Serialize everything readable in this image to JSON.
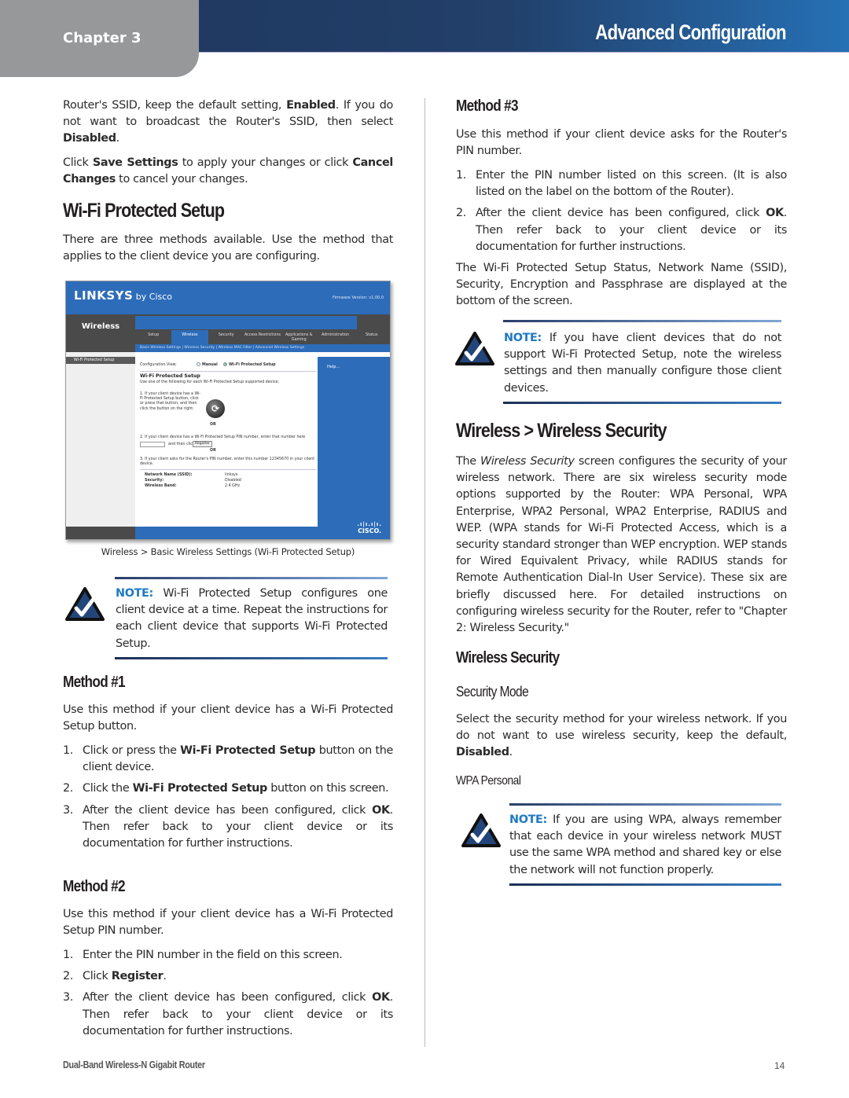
{
  "header": {
    "chapter": "Chapter 3",
    "title": "Advanced Configuration",
    "colors": {
      "bar_start": "#1e355c",
      "bar_end": "#2670b5",
      "tab": "#97989a"
    }
  },
  "left": {
    "intro1": {
      "pre": "Router's SSID, keep the default setting, ",
      "b1": "Enabled",
      "mid": ". If you do not want to broadcast the Router's SSID, then select ",
      "b2": "Disabled",
      "post": "."
    },
    "intro2": {
      "pre": "Click ",
      "b1": "Save Settings",
      "mid": " to apply your changes or click ",
      "b2": "Cancel Changes",
      "post": " to cancel your changes."
    },
    "wps_heading": "Wi-Fi Protected Setup",
    "wps_intro": "There are three methods available. Use the method that applies to the client device you are configuring.",
    "figure": {
      "logo": "LINKSYS",
      "logo_suffix": "by Cisco",
      "firmware": "Firmware Version: v1.00.0",
      "section": "Wireless",
      "tabs": [
        "Setup",
        "Wireless",
        "Security",
        "Access Restrictions",
        "Applications & Gaming",
        "Administration",
        "Status"
      ],
      "active_tab": "Wireless",
      "subnav": "Basic Wireless Settings   |   Wireless Security   |   Wireless MAC Filter   |   Advanced Wireless Settings",
      "side_item": "Wi-Fi Protected Setup",
      "config_view_label": "Configuration View:",
      "radio_manual": "Manual",
      "radio_wps": "Wi-Fi Protected Setup",
      "wps_title": "Wi-Fi Protected Setup",
      "wps_desc": "Use one of the following for each Wi-Fi Protected Setup supported device:",
      "step1": "1. If your client device has a Wi-Fi Protected Setup button, click or press that button, and then click the button on the right.",
      "or": "OR",
      "step2": "2. If your client device has a Wi-Fi Protected Setup PIN number, enter that number here",
      "step2b": "and then click",
      "register": "Register",
      "step3": "3. If your client asks for the Router's PIN number, enter this number 12345670 in your client device.",
      "status_rows": [
        {
          "label": "Network Name (SSID):",
          "value": "linksys"
        },
        {
          "label": "Security:",
          "value": "Disabled"
        },
        {
          "label": "Wireless Band:",
          "value": "2.4 GHz"
        }
      ],
      "help": "Help...",
      "cisco": "CISCO."
    },
    "caption": "Wireless > Basic Wireless Settings (Wi-Fi Protected Setup)",
    "note1": {
      "label": "NOTE:",
      "text": " Wi-Fi Protected Setup configures one client device at a time. Repeat the instructions for each client device that supports Wi-Fi Protected Setup."
    },
    "method1": {
      "heading": "Method #1",
      "intro": "Use this method if your client device has a Wi-Fi Protected Setup button.",
      "steps": [
        {
          "num": "1.",
          "pre": "Click or press the ",
          "b": "Wi-Fi Protected Setup",
          "post": " button on the client device."
        },
        {
          "num": "2.",
          "pre": "Click the ",
          "b": "Wi-Fi Protected Setup",
          "post": " button on this screen."
        },
        {
          "num": "3.",
          "pre": "After the client device has been configured, click ",
          "b": "OK",
          "post": ". Then refer back to your client device or its documentation for further instructions."
        }
      ]
    },
    "method2": {
      "heading": "Method #2",
      "intro": "Use this method if your client device has a Wi-Fi Protected Setup PIN number.",
      "steps": [
        {
          "num": "1.",
          "pre": "Enter the PIN number in the field on this screen.",
          "b": "",
          "post": ""
        },
        {
          "num": "2.",
          "pre": "Click ",
          "b": "Register",
          "post": "."
        },
        {
          "num": "3.",
          "pre": "After the client device has been configured, click ",
          "b": "OK",
          "post": ". Then refer back to your client device or its documentation for further instructions."
        }
      ]
    }
  },
  "right": {
    "method3": {
      "heading": "Method #3",
      "intro": "Use this method if your client device asks for the Router's PIN number.",
      "steps": [
        {
          "num": "1.",
          "pre": "Enter the PIN number listed on this screen. (It is also listed on the label on the bottom of the Router).",
          "b": "",
          "post": ""
        },
        {
          "num": "2.",
          "pre": "After the client device has been configured, click ",
          "b": "OK",
          "post": ". Then refer back to your client device or its documentation for further instructions."
        }
      ],
      "outro": "The Wi-Fi Protected Setup Status, Network Name (SSID), Security, Encryption and Passphrase are displayed at the bottom of the screen."
    },
    "note2": {
      "label": "NOTE:",
      "text": " If you have client devices that do not support Wi-Fi Protected Setup, note the wireless settings and then manually configure those client devices."
    },
    "ws_heading": "Wireless > Wireless Security",
    "ws_intro": {
      "pre": "The ",
      "i": "Wireless Security",
      "post": " screen configures the security of your wireless network. There are six wireless security mode options supported by the Router: WPA Personal, WPA Enterprise, WPA2 Personal, WPA2 Enterprise, RADIUS and WEP. (WPA stands for Wi-Fi Protected Access, which is a security standard stronger than WEP encryption. WEP stands for Wired Equivalent Privacy, while RADIUS stands for Remote Authentication Dial-In User Service). These six are briefly discussed here. For detailed instructions on configuring wireless security for the Router, refer to \"Chapter 2: Wireless Security.\""
    },
    "ws_sub": "Wireless Security",
    "mode_heading": "Security Mode",
    "mode_text": {
      "pre": "Select the security method for your wireless network. If you do not want to use wireless security, keep the default, ",
      "b": "Disabled",
      "post": "."
    },
    "wpa_heading": "WPA Personal",
    "note3": {
      "label": "NOTE:",
      "text": " If you are using WPA, always remember that each device in your wireless network MUST use the same WPA method and shared key or else the network will not function properly."
    }
  },
  "footer": {
    "product": "Dual-Band Wireless-N Gigabit Router",
    "page": "14"
  }
}
